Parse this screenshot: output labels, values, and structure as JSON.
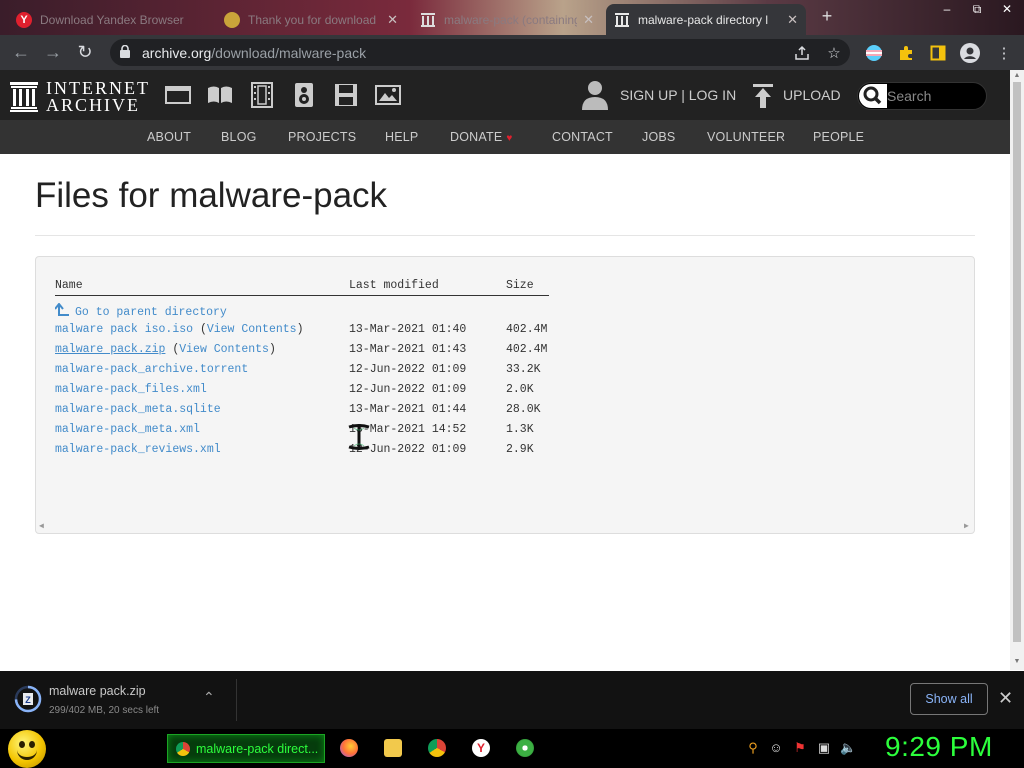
{
  "browser": {
    "tabs": [
      {
        "title": "Download Yandex Browser",
        "icon": "yandex-icon",
        "active": false
      },
      {
        "title": "Thank you for download",
        "icon": "generic-page-icon",
        "active": false
      },
      {
        "title": "malware-pack (containing",
        "icon": "internet-archive-icon",
        "active": false
      },
      {
        "title": "malware-pack directory l",
        "icon": "internet-archive-icon",
        "active": true
      }
    ],
    "close_glyph": "✕",
    "new_tab_glyph": "+",
    "url_host": "archive.org",
    "url_path": "/download/malware-pack"
  },
  "ia": {
    "logo_line1": "INTERNET",
    "logo_line2": "ARCHIVE",
    "signup": "SIGN UP | LOG IN",
    "upload": "UPLOAD",
    "search_placeholder": "Search",
    "subnav": [
      "ABOUT",
      "BLOG",
      "PROJECTS",
      "HELP",
      "DONATE",
      "CONTACT",
      "JOBS",
      "VOLUNTEER",
      "PEOPLE"
    ],
    "donate_heart": "♥"
  },
  "page": {
    "title": "Files for malware-pack",
    "columns": {
      "name": "Name",
      "modified": "Last modified",
      "size": "Size"
    },
    "parent_label": "Go to parent directory",
    "files": [
      {
        "name": "malware pack iso.iso",
        "extra": "View Contents",
        "modified": "13-Mar-2021 01:40",
        "size": "402.4M"
      },
      {
        "name": "malware pack.zip",
        "extra": "View Contents",
        "modified": "13-Mar-2021 01:43",
        "size": "402.4M"
      },
      {
        "name": "malware-pack_archive.torrent",
        "extra": "",
        "modified": "12-Jun-2022 01:09",
        "size": "33.2K"
      },
      {
        "name": "malware-pack_files.xml",
        "extra": "",
        "modified": "12-Jun-2022 01:09",
        "size": "2.0K"
      },
      {
        "name": "malware-pack_meta.sqlite",
        "extra": "",
        "modified": "13-Mar-2021 01:44",
        "size": "28.0K"
      },
      {
        "name": "malware-pack_meta.xml",
        "extra": "",
        "modified": "13-Mar-2021 14:52",
        "size": "1.3K"
      },
      {
        "name": "malware-pack_reviews.xml",
        "extra": "",
        "modified": "12-Jun-2022 01:09",
        "size": "2.9K"
      }
    ]
  },
  "download": {
    "filename": "malware pack.zip",
    "status": "299/402 MB, 20 secs left",
    "show_all": "Show all",
    "progress_fraction": 0.744
  },
  "taskbar": {
    "active_window": "malware-pack direct...",
    "clock": "9:29 PM"
  },
  "colors": {
    "link": "#428bca",
    "taskbar_green": "#2cff3c",
    "ia_dark": "#222222"
  }
}
